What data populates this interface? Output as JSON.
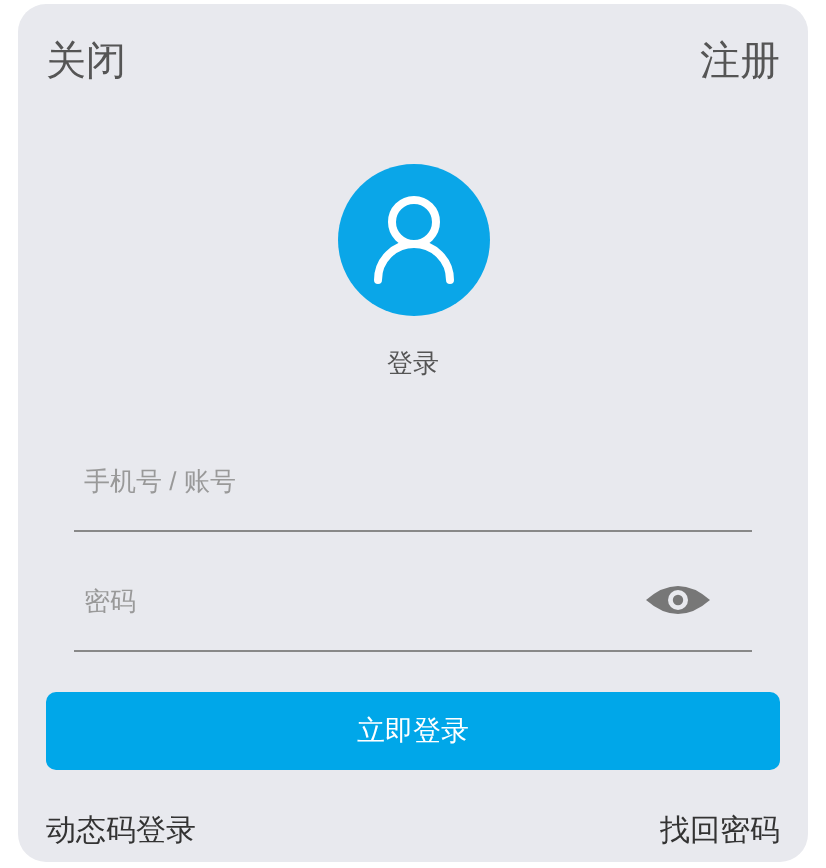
{
  "header": {
    "close": "关闭",
    "register": "注册"
  },
  "avatar_label": "登录",
  "fields": [
    {
      "kind": "text",
      "placeholder": "手机号 / 账号"
    },
    {
      "kind": "password",
      "placeholder": "密码"
    }
  ],
  "login_button": "立即登录",
  "links": [
    "动态码登录",
    "找回密码"
  ]
}
